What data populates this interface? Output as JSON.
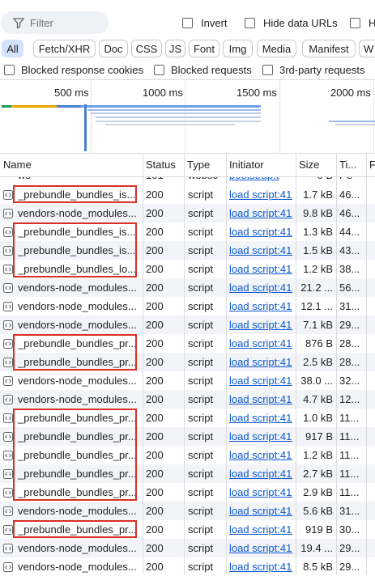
{
  "filter": {
    "placeholder": "Filter"
  },
  "toolbar": {
    "invert": "Invert",
    "hide_data_urls": "Hide data URLs",
    "hide_ext_cut": "Hid"
  },
  "type_filters": [
    "All",
    "Fetch/XHR",
    "Doc",
    "CSS",
    "JS",
    "Font",
    "Img",
    "Media",
    "Manifest",
    "W"
  ],
  "blocked": {
    "blocked_response_cookies": "Blocked response cookies",
    "blocked_requests": "Blocked requests",
    "third_party": "3rd-party requests"
  },
  "timeline": {
    "ticks": [
      "500 ms",
      "1000 ms",
      "1500 ms",
      "2000 ms"
    ]
  },
  "columns": {
    "name": "Name",
    "status": "Status",
    "type": "Type",
    "initiator": "Initiator",
    "size": "Size",
    "time": "Ti...",
    "fulfilled": "F"
  },
  "partial_row": {
    "name": "ws",
    "status": "101",
    "type": "websc",
    "initiator": "bootstrap.t",
    "size": "0 B",
    "time": "Pe"
  },
  "rows": [
    {
      "name": "_prebundle_bundles_is...",
      "status": "200",
      "type": "script",
      "initiator": "load script:41...",
      "size": "1.7 kB",
      "time": "46..."
    },
    {
      "name": "vendors-node_modules...",
      "status": "200",
      "type": "script",
      "initiator": "load script:41...",
      "size": "9.8 kB",
      "time": "46..."
    },
    {
      "name": "_prebundle_bundles_is...",
      "status": "200",
      "type": "script",
      "initiator": "load script:41...",
      "size": "1.3 kB",
      "time": "44..."
    },
    {
      "name": "_prebundle_bundles_is...",
      "status": "200",
      "type": "script",
      "initiator": "load script:41...",
      "size": "1.5 kB",
      "time": "43..."
    },
    {
      "name": "_prebundle_bundles_lo...",
      "status": "200",
      "type": "script",
      "initiator": "load script:41...",
      "size": "1.2 kB",
      "time": "38..."
    },
    {
      "name": "vendors-node_modules...",
      "status": "200",
      "type": "script",
      "initiator": "load script:41...",
      "size": "21.2 ...",
      "time": "56..."
    },
    {
      "name": "vendors-node_modules...",
      "status": "200",
      "type": "script",
      "initiator": "load script:41...",
      "size": "12.1 ...",
      "time": "31..."
    },
    {
      "name": "vendors-node_modules...",
      "status": "200",
      "type": "script",
      "initiator": "load script:41...",
      "size": "7.1 kB",
      "time": "29..."
    },
    {
      "name": "_prebundle_bundles_pr...",
      "status": "200",
      "type": "script",
      "initiator": "load script:41...",
      "size": "876 B",
      "time": "28..."
    },
    {
      "name": "_prebundle_bundles_pr...",
      "status": "200",
      "type": "script",
      "initiator": "load script:41...",
      "size": "2.5 kB",
      "time": "28..."
    },
    {
      "name": "vendors-node_modules...",
      "status": "200",
      "type": "script",
      "initiator": "load script:41...",
      "size": "38.0 ...",
      "time": "32..."
    },
    {
      "name": "vendors-node_modules...",
      "status": "200",
      "type": "script",
      "initiator": "load script:41...",
      "size": "4.7 kB",
      "time": "12..."
    },
    {
      "name": "_prebundle_bundles_pr...",
      "status": "200",
      "type": "script",
      "initiator": "load script:41...",
      "size": "1.0 kB",
      "time": "11..."
    },
    {
      "name": "_prebundle_bundles_pr...",
      "status": "200",
      "type": "script",
      "initiator": "load script:41...",
      "size": "917 B",
      "time": "11..."
    },
    {
      "name": "_prebundle_bundles_pr...",
      "status": "200",
      "type": "script",
      "initiator": "load script:41...",
      "size": "1.2 kB",
      "time": "11..."
    },
    {
      "name": "_prebundle_bundles_pr...",
      "status": "200",
      "type": "script",
      "initiator": "load script:41...",
      "size": "2.7 kB",
      "time": "11..."
    },
    {
      "name": "_prebundle_bundles_pr...",
      "status": "200",
      "type": "script",
      "initiator": "load script:41...",
      "size": "2.9 kB",
      "time": "11..."
    },
    {
      "name": "vendors-node_modules...",
      "status": "200",
      "type": "script",
      "initiator": "load script:41...",
      "size": "5.6 kB",
      "time": "31..."
    },
    {
      "name": "_prebundle_bundles_pr...",
      "status": "200",
      "type": "script",
      "initiator": "load script:41...",
      "size": "919 B",
      "time": "30..."
    },
    {
      "name": "vendors-node_modules...",
      "status": "200",
      "type": "script",
      "initiator": "load script:41...",
      "size": "19.4 ...",
      "time": "29..."
    },
    {
      "name": "vendors-node_modules...",
      "status": "200",
      "type": "script",
      "initiator": "load script:41...",
      "size": "8.5 kB",
      "time": "29..."
    }
  ],
  "highlight_color": "#d93025",
  "link_color": "#0b57d0",
  "active_chip_color": "#d3e3fd"
}
